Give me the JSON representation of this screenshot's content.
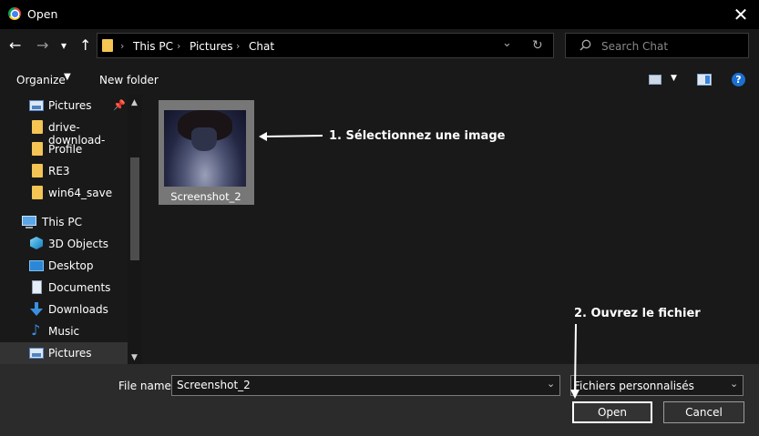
{
  "window": {
    "title": "Open",
    "close_glyph": "✕"
  },
  "nav": {
    "back_glyph": "←",
    "forward_glyph": "→",
    "dropdown_glyph": "▾",
    "up_glyph": "↑",
    "breadcrumbs": [
      "This PC",
      "Pictures",
      "Chat"
    ],
    "separator": "›",
    "refresh_glyph": "↻",
    "address_dropdown_glyph": "⌄"
  },
  "search": {
    "placeholder": "Search Chat"
  },
  "toolbar": {
    "organize_label": "Organize",
    "new_folder_label": "New folder"
  },
  "sidebar": {
    "items": [
      {
        "label": "Pictures",
        "icon": "pictures-icon",
        "pinned": true
      },
      {
        "label": "drive-download-",
        "icon": "folder-icon"
      },
      {
        "label": "Profile",
        "icon": "folder-icon"
      },
      {
        "label": "RE3",
        "icon": "folder-icon"
      },
      {
        "label": "win64_save",
        "icon": "folder-icon"
      },
      {
        "label": "This PC",
        "icon": "computer-icon"
      },
      {
        "label": "3D Objects",
        "icon": "3d-objects-icon"
      },
      {
        "label": "Desktop",
        "icon": "desktop-icon"
      },
      {
        "label": "Documents",
        "icon": "documents-icon"
      },
      {
        "label": "Downloads",
        "icon": "downloads-icon"
      },
      {
        "label": "Music",
        "icon": "music-icon"
      },
      {
        "label": "Pictures",
        "icon": "pictures-icon",
        "selected": true
      }
    ]
  },
  "files": [
    {
      "name": "Screenshot_2",
      "type": "image"
    }
  ],
  "annotations": {
    "step1": "1. Sélectionnez une image",
    "step2": "2. Ouvrez le fichier"
  },
  "bottom": {
    "file_name_label": "File name:",
    "file_name_value": "Screenshot_2",
    "filter_value": "Fichiers personnalisés",
    "open_label": "Open",
    "cancel_label": "Cancel"
  },
  "colors": {
    "background": "#191919",
    "folder": "#f4c454",
    "accent_blue": "#1e90ff",
    "help_blue": "#1c6fd1"
  }
}
